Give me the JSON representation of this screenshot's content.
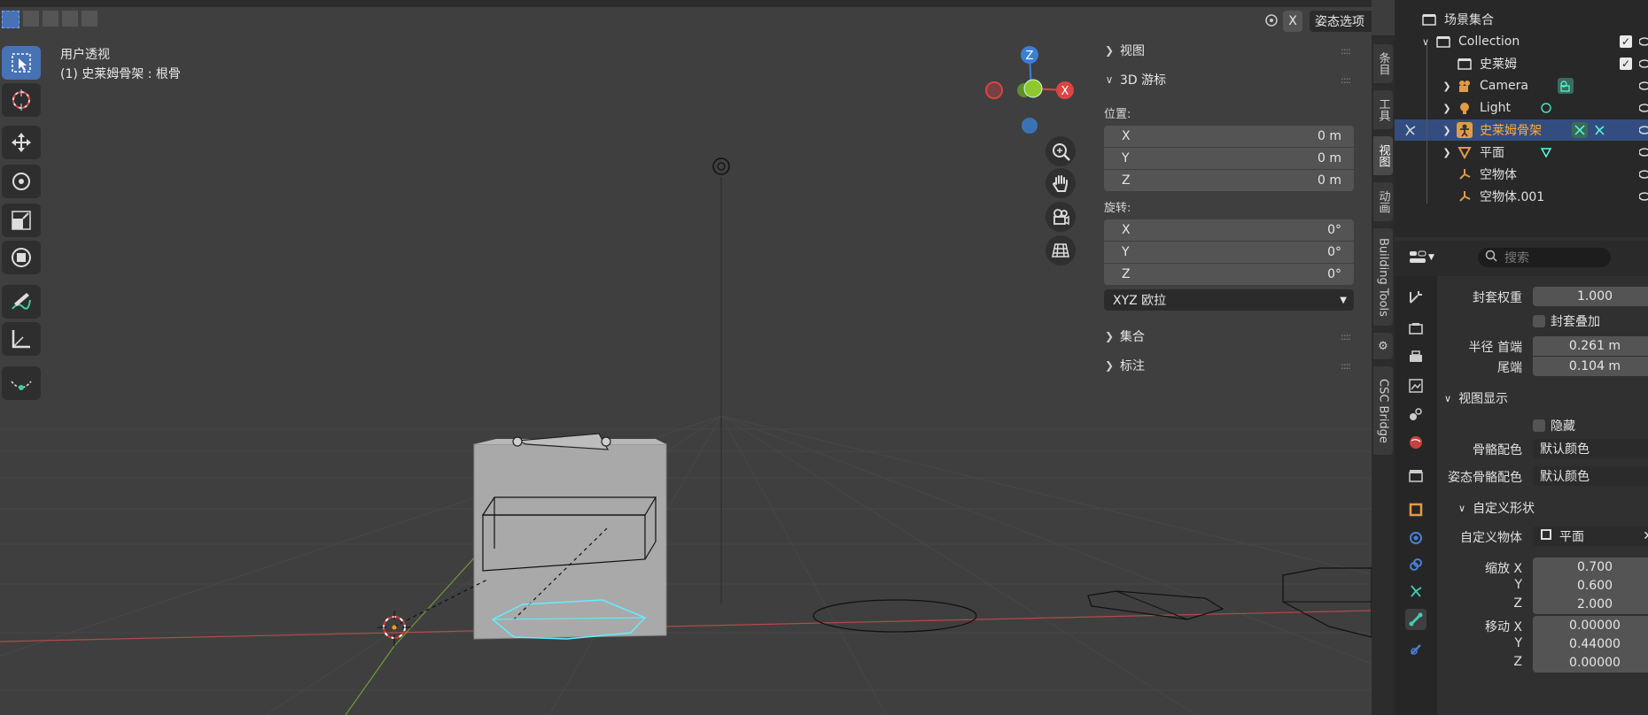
{
  "viewport": {
    "view_name": "用户透视",
    "active_info": "(1) 史莱姆骨架 : 根骨",
    "header_x_label": "X",
    "pose_options": "姿态选项",
    "gizmo": {
      "z": "Z",
      "x": "X"
    }
  },
  "npanel": {
    "view_section": "视图",
    "cursor_section": "3D 游标",
    "location_label": "位置:",
    "location": [
      {
        "axis": "X",
        "value": "0 m"
      },
      {
        "axis": "Y",
        "value": "0 m"
      },
      {
        "axis": "Z",
        "value": "0 m"
      }
    ],
    "rotation_label": "旋转:",
    "rotation": [
      {
        "axis": "X",
        "value": "0°"
      },
      {
        "axis": "Y",
        "value": "0°"
      },
      {
        "axis": "Z",
        "value": "0°"
      }
    ],
    "rotation_mode": "XYZ 欧拉",
    "collection_section": "集合",
    "annotation_section": "标注"
  },
  "vtabs": [
    "条目",
    "工具",
    "视图",
    "动画",
    "Building Tools",
    "CSC Bridge"
  ],
  "outliner": {
    "scene_collection": "场景集合",
    "rows": [
      {
        "name": "Collection",
        "indent": 1
      },
      {
        "name": "史莱姆",
        "indent": 2
      },
      {
        "name": "Camera",
        "indent": 2
      },
      {
        "name": "Light",
        "indent": 2
      },
      {
        "name": "史莱姆骨架",
        "indent": 2
      },
      {
        "name": "平面",
        "indent": 2
      },
      {
        "name": "空物体",
        "indent": 2
      },
      {
        "name": "空物体.001",
        "indent": 2
      }
    ]
  },
  "properties": {
    "search_placeholder": "搜索",
    "envelope_weight_label": "封套权重",
    "envelope_weight": "1.000",
    "envelope_multiply_label": "封套叠加",
    "radius_head_label": "半径 首端",
    "radius_head": "0.261 m",
    "radius_tail_label": "尾端",
    "radius_tail": "0.104 m",
    "viewport_display_section": "视图显示",
    "hide_label": "隐藏",
    "bone_color_label": "骨骼配色",
    "bone_color": "默认颜色",
    "pose_bone_color_label": "姿态骨骼配色",
    "pose_bone_color": "默认颜色",
    "custom_shape_section": "自定义形状",
    "custom_object_label": "自定义物体",
    "custom_object": "平面",
    "scale_x_label": "缩放 X",
    "scale_x": "0.700",
    "scale_y_label": "Y",
    "scale_y": "0.600",
    "scale_z_label": "Z",
    "scale_z": "2.000",
    "move_x_label": "移动 X",
    "move_x": "0.00000",
    "move_y_label": "Y",
    "move_y": "0.44000",
    "move_z_label": "Z",
    "move_z": "0.00000"
  },
  "colors": {
    "accent": "#4772b3",
    "selected_row": "#334d80",
    "active_name": "#ffaf29"
  }
}
